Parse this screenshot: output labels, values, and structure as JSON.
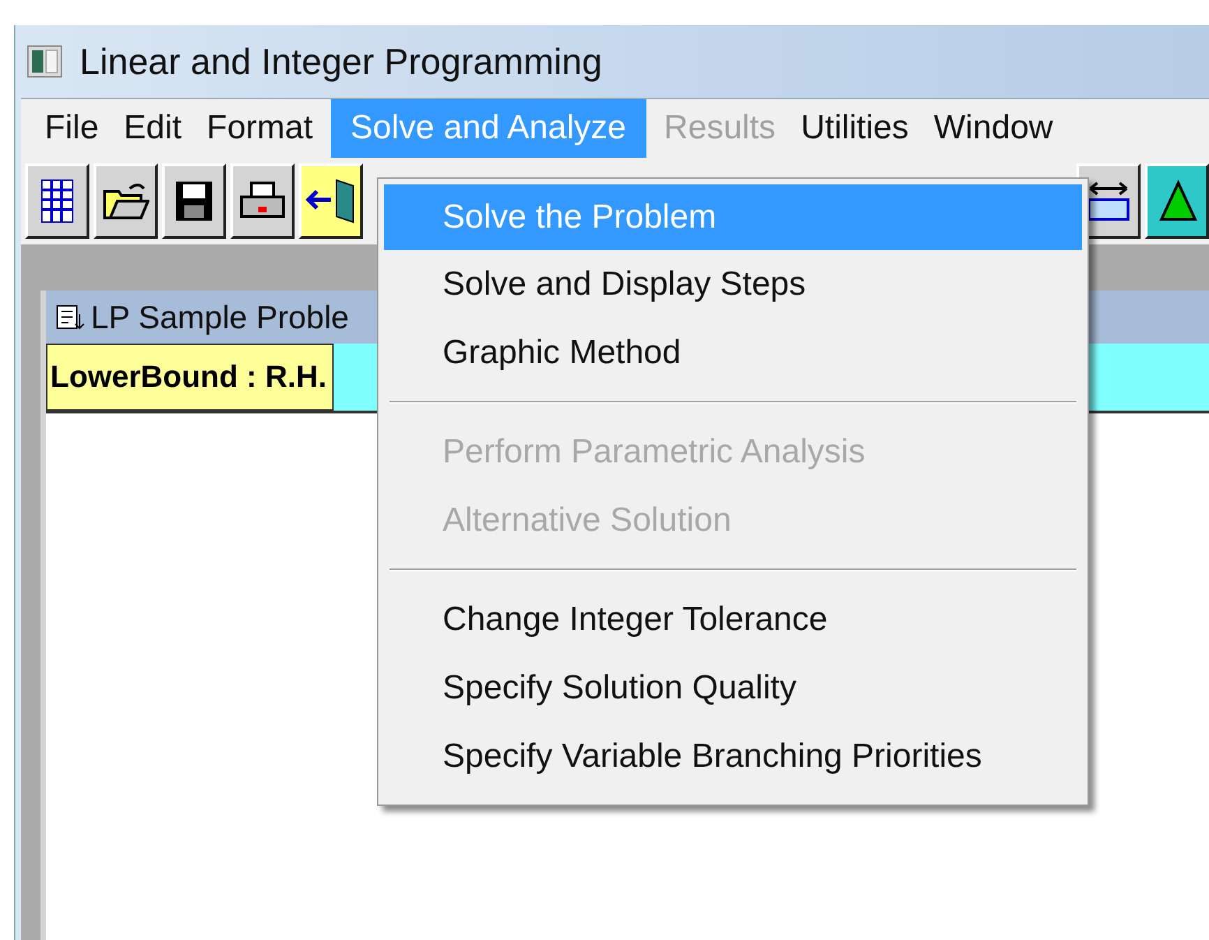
{
  "window": {
    "title": "Linear and Integer Programming"
  },
  "menu_bar": [
    {
      "label": "File",
      "selected": false,
      "disabled": false
    },
    {
      "label": "Edit",
      "selected": false,
      "disabled": false
    },
    {
      "label": "Format",
      "selected": false,
      "disabled": false
    },
    {
      "label": "Solve and Analyze",
      "selected": true,
      "disabled": false
    },
    {
      "label": "Results",
      "selected": false,
      "disabled": true
    },
    {
      "label": "Utilities",
      "selected": false,
      "disabled": false
    },
    {
      "label": "Window",
      "selected": false,
      "disabled": false
    }
  ],
  "dropdown": {
    "items": [
      {
        "kind": "item",
        "label": "Solve the Problem",
        "selected": true,
        "disabled": false
      },
      {
        "kind": "item",
        "label": "Solve and Display Steps",
        "selected": false,
        "disabled": false
      },
      {
        "kind": "item",
        "label": "Graphic Method",
        "selected": false,
        "disabled": false
      },
      {
        "kind": "separator"
      },
      {
        "kind": "item",
        "label": "Perform Parametric Analysis",
        "selected": false,
        "disabled": true
      },
      {
        "kind": "item",
        "label": "Alternative Solution",
        "selected": false,
        "disabled": true
      },
      {
        "kind": "separator"
      },
      {
        "kind": "item",
        "label": "Change Integer Tolerance",
        "selected": false,
        "disabled": false
      },
      {
        "kind": "item",
        "label": "Specify Solution Quality",
        "selected": false,
        "disabled": false
      },
      {
        "kind": "item",
        "label": "Specify Variable Branching Priorities",
        "selected": false,
        "disabled": false
      }
    ]
  },
  "child_window": {
    "title": "LP Sample Proble",
    "header_cell": "LowerBound : R.H."
  }
}
